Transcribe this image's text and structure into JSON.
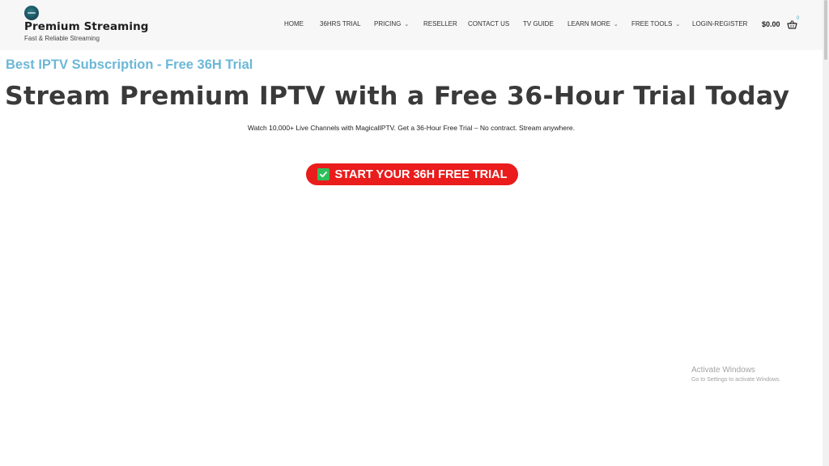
{
  "header": {
    "site_title": "Premium Streaming",
    "tagline": "Fast & Reliable Streaming",
    "logo_icon": "logo-icon"
  },
  "nav": {
    "items": [
      {
        "label": "HOME",
        "has_dropdown": false
      },
      {
        "label": "36HRS TRIAL",
        "has_dropdown": false
      },
      {
        "label": "PRICING",
        "has_dropdown": true
      },
      {
        "label": "RESELLER",
        "has_dropdown": false
      },
      {
        "label": "CONTACT US",
        "has_dropdown": false
      },
      {
        "label": "TV GUIDE",
        "has_dropdown": false
      },
      {
        "label": "LEARN MORE",
        "has_dropdown": true
      },
      {
        "label": "FREE TOOLS",
        "has_dropdown": true
      },
      {
        "label": "LOGIN-REGISTER",
        "has_dropdown": false
      }
    ],
    "chevron_icon": "chevron-down-icon"
  },
  "cart": {
    "amount": "$0.00",
    "count": "0",
    "icon": "shopping-basket-icon"
  },
  "hero": {
    "eyebrow": "Best IPTV Subscription - Free 36H Trial",
    "title": "Stream Premium IPTV with a Free 36-Hour Trial Today",
    "subtitle": "Watch 10,000+ Live Channels with MagicalIPTV. Get a 36-Hour Free Trial – No contract. Stream anywhere.",
    "cta_label": "START YOUR 36H FREE TRIAL",
    "cta_icon": "check-mark-icon"
  },
  "watermark": {
    "title": "Activate Windows",
    "subtitle": "Go to Settings to activate Windows."
  },
  "colors": {
    "header_bg": "#f7f7f7",
    "eyebrow": "#6cb7d7",
    "title": "#3a3a3a",
    "cta_bg": "#ea1c1c",
    "check_bg": "#2fbf5a",
    "badge": "#3fa9c9"
  }
}
